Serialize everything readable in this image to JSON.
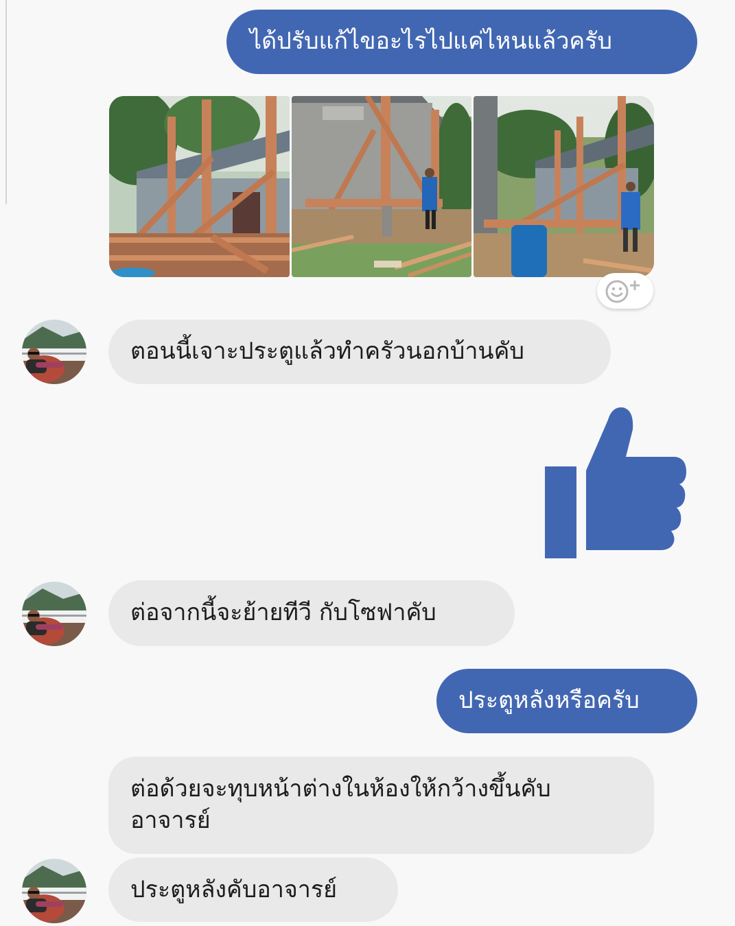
{
  "colors": {
    "outgoing": "#4267b2",
    "incoming": "#e9e9e9",
    "like": "#4267b2"
  },
  "messages": {
    "m1_out": "ได้ปรับแก้ไขอะไรไปแค่ไหนแล้วครับ",
    "m2_in": "ตอนนี้เจาะประตูแล้วทำครัวนอกบ้านคับ",
    "m3_in": "ต่อจากนี้จะย้ายทีวี กับโซฟาคับ",
    "m4_out": "ประตูหลังหรือครับ",
    "m5_in_line1": "ต่อด้วยจะทุบหน้าต่างในห้องให้กว้างขึ้นคับ",
    "m5_in_line2": "อาจารย์",
    "m6_in": "ประตูหลังคับอาจารย์"
  },
  "icons": {
    "reaction": "add-reaction-icon",
    "like": "thumbs-up-icon"
  }
}
